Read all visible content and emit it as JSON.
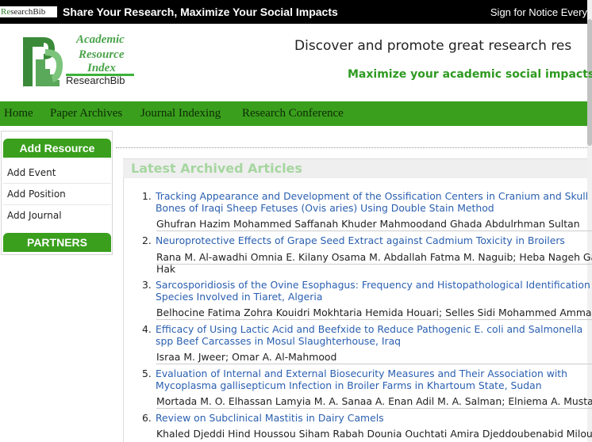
{
  "topbar": {
    "badge_prefix": "Re",
    "badge_rest": "searchBib",
    "slogan": "Share Your Research, Maximize Your Social Impacts",
    "signup": "Sign for Notice Every"
  },
  "logo": {
    "line1": "Academic",
    "line2": "Resource",
    "line3": "Index",
    "brand": "ResearchBib"
  },
  "header": {
    "headline": "Discover and promote great research res",
    "tagline": "Maximize your academic social impacts."
  },
  "nav": [
    "Home",
    "Paper Archives",
    "Journal Indexing",
    "Research Conference"
  ],
  "sidebar": {
    "add_resource": "Add Resource",
    "items": [
      "Add Event",
      "Add Position",
      "Add Journal"
    ],
    "partners": "PARTNERS"
  },
  "articles_heading": "Latest Archived Articles",
  "articles": [
    {
      "num": "1.",
      "title": "Tracking Appearance and Development of the Ossification Centers in Cranium and Skull B Bones of Iraqi Sheep Fetuses (Ovis aries) Using Double Stain Method",
      "authors": "Ghufran Hazim Mohammed Saffanah Khuder Mahmoodand Ghada Abdulrhman Sultan"
    },
    {
      "num": "2.",
      "title": "Neuroprotective Effects of Grape Seed Extract against Cadmium Toxicity in Broilers",
      "authors": "Rana M. Al-awadhi Omnia E. Kilany Osama M. Abdallah Fatma M. Naguib; Heba Nageh Ga",
      "authors_cont": "Hak"
    },
    {
      "num": "3.",
      "title": "Sarcosporidiosis of the Ovine Esophagus: Frequency and Histopathological Identification o Species Involved in Tiaret, Algeria",
      "authors": "Belhocine Fatima Zohra Kouidri Mokhtaria Hemida Houari; Selles Sidi Mohammed Ammar"
    },
    {
      "num": "4.",
      "title": "Efficacy of Using Lactic Acid and Beefxide to Reduce Pathogenic E. coli and Salmonella spp Beef Carcasses in Mosul Slaughterhouse, Iraq",
      "authors": "Israa M. Jweer; Omar A. Al-Mahmood"
    },
    {
      "num": "5.",
      "title": "Evaluation of Internal and External Biosecurity Measures and Their Association with Mycoplasma gallisepticum Infection in Broiler Farms in Khartoum State, Sudan",
      "authors": "Mortada M. O. Elhassan Lamyia M. A. Sanaa A. Enan Adil M. A. Salman; Elniema A. Musta"
    },
    {
      "num": "6.",
      "title": "Review on Subclinical Mastitis in Dairy Camels",
      "authors": "Khaled Djeddi Hind Houssou Siham Rabah Dounia Ouchtati Amira Djeddoubenabid Miloud"
    }
  ]
}
